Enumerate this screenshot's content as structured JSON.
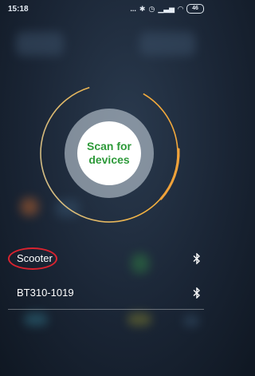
{
  "status_bar": {
    "time": "15:18",
    "signal_text": "...",
    "battery": "46"
  },
  "scan": {
    "label": "Scan for devices"
  },
  "devices": [
    {
      "name": "Scooter",
      "icon": "bluetooth-icon"
    },
    {
      "name": "BT310-1019",
      "icon": "bluetooth-icon"
    }
  ],
  "colors": {
    "accent_green": "#2e9a3a",
    "ring_orange": "#f0a23a",
    "highlight_red": "#d9232f"
  }
}
